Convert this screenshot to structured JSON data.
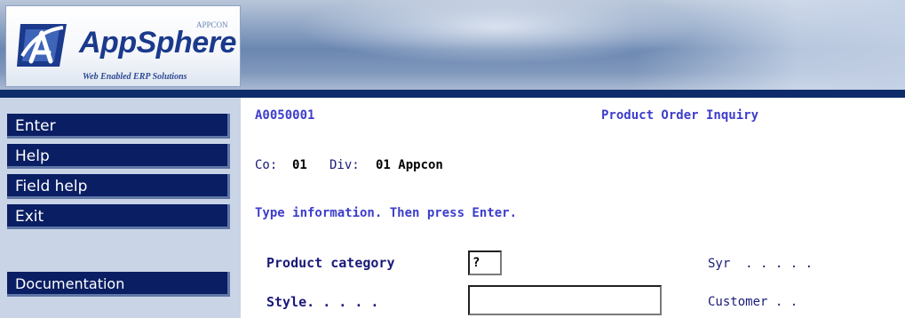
{
  "header": {
    "logo_name": "AppSphere",
    "logo_small": "APPCON",
    "logo_tagline": "Web Enabled ERP Solutions",
    "logo_icon": "appsphere-logo-icon"
  },
  "sidebar": {
    "items": [
      {
        "label": "Enter"
      },
      {
        "label": "Help"
      },
      {
        "label": "Field help"
      },
      {
        "label": "Exit"
      }
    ],
    "documentation_label": "Documentation"
  },
  "screen": {
    "program_id": "A0050001",
    "title": "Product Order Inquiry",
    "co_label": "Co:",
    "co_value": "01",
    "div_label": "Div:",
    "div_value": "01 Appcon",
    "instruction": "Type information. Then press Enter."
  },
  "form": {
    "product_category_label": "Product category",
    "product_category_value": "?",
    "style_label": "Style. . . . .",
    "style_value": "",
    "syr_label": "Syr  . . . . .",
    "customer_label": "Customer . ."
  },
  "colors": {
    "button_bg": "#0a1e63",
    "divider": "#0e2c6a",
    "sidebar_bg": "#c9d5e6",
    "label_blue": "#3d3dcc"
  }
}
